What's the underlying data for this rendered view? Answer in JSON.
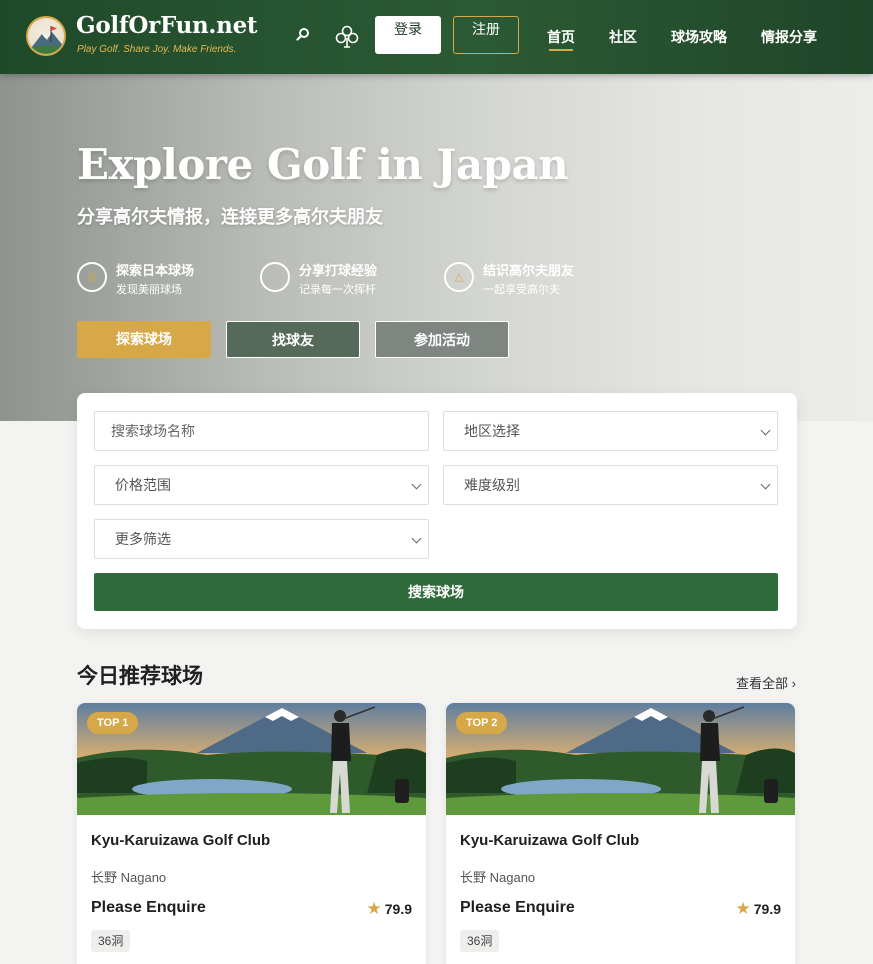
{
  "header": {
    "site_name": "GolfOrFun.net",
    "tagline": "Play Golf. Share Joy. Make Friends.",
    "login_label": "登录",
    "register_label": "注册",
    "nav": [
      {
        "label": "首页"
      },
      {
        "label": "社区"
      },
      {
        "label": "球场攻略"
      },
      {
        "label": "情报分享"
      }
    ]
  },
  "hero": {
    "title": "Explore Golf in Japan",
    "subtitle": "分享高尔夫情报，连接更多高尔夫朋友",
    "features": [
      {
        "title": "探索日本球场",
        "desc": "发现美丽球场"
      },
      {
        "title": "分享打球经验",
        "desc": "记录每一次挥杆"
      },
      {
        "title": "结识高尔夫朋友",
        "desc": "一起享受高尔夫"
      }
    ],
    "buttons": {
      "explore": "探索球场",
      "find_friends": "找球友",
      "events": "参加活动"
    }
  },
  "search": {
    "name_placeholder": "搜索球场名称",
    "region": "地区选择",
    "price": "价格范围",
    "difficulty": "难度级别",
    "more": "更多筛选",
    "submit": "搜索球场"
  },
  "recommended": {
    "title": "今日推荐球场",
    "view_all": "查看全部 ›",
    "cards": [
      {
        "badge": "TOP 1",
        "name": "Kyu-Karuizawa Golf Club",
        "location": "长野 Nagano",
        "price": "Please Enquire",
        "rating": "79.9",
        "holes": "36洞"
      },
      {
        "badge": "TOP 2",
        "name": "Kyu-Karuizawa Golf Club",
        "location": "长野 Nagano",
        "price": "Please Enquire",
        "rating": "79.9",
        "holes": "36洞"
      }
    ]
  },
  "colors": {
    "header_green": "#2c5a34",
    "gold_accent": "#d6a848",
    "button_green": "#2f6a3a"
  }
}
